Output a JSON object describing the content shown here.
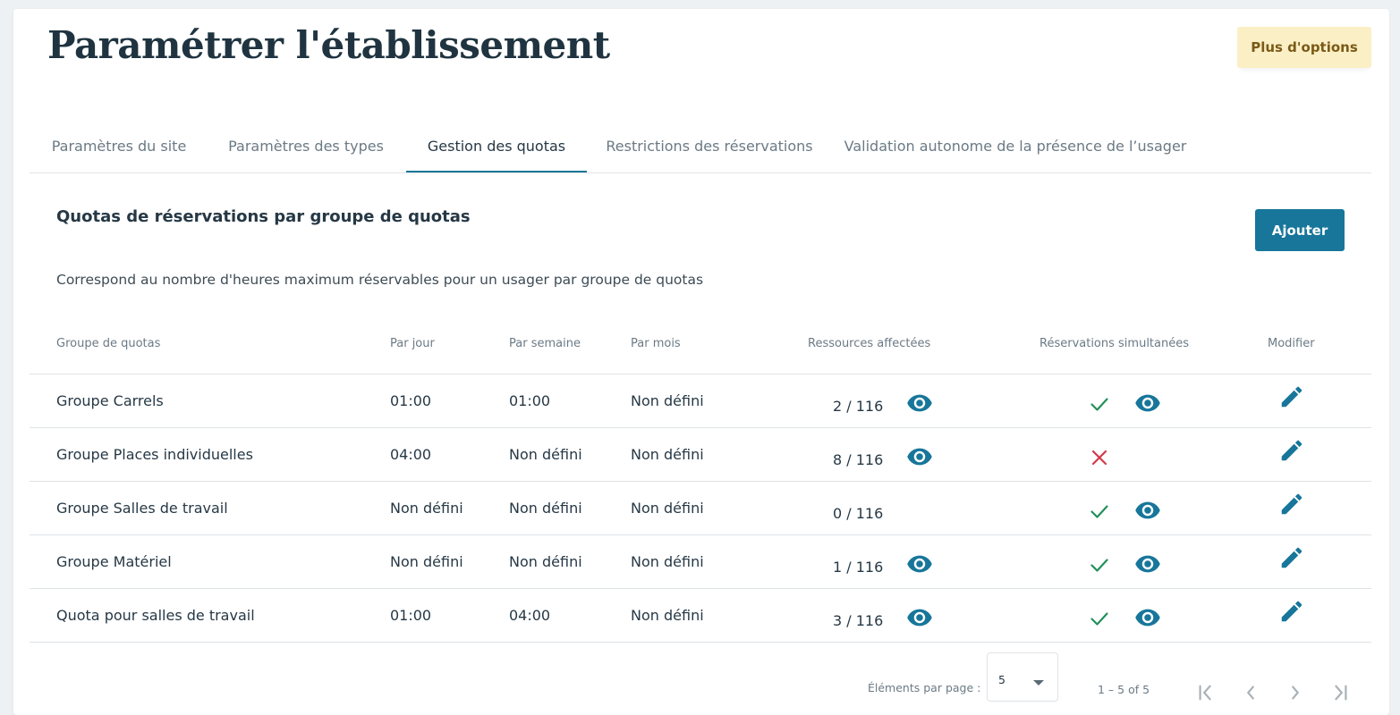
{
  "header": {
    "title": "Paramétrer l'établissement",
    "more_options_label": "Plus d'options"
  },
  "tabs": [
    {
      "label": "Paramètres du site",
      "active": false
    },
    {
      "label": "Paramètres des types",
      "active": false
    },
    {
      "label": "Gestion des quotas",
      "active": true
    },
    {
      "label": "Restrictions des réservations",
      "active": false
    },
    {
      "label": "Validation autonome de la présence de l’usager",
      "active": false
    }
  ],
  "section": {
    "title": "Quotas de réservations par groupe de quotas",
    "add_label": "Ajouter",
    "description": "Correspond au nombre d'heures maximum réservables pour un usager par groupe de quotas"
  },
  "table": {
    "columns": {
      "group": "Groupe de quotas",
      "day": "Par jour",
      "week": "Par semaine",
      "month": "Par mois",
      "resources": "Ressources affectées",
      "simultaneous": "Réservations simultanées",
      "edit": "Modifier"
    },
    "rows": [
      {
        "group": "Groupe Carrels",
        "day": "01:00",
        "week": "01:00",
        "month": "Non défini",
        "resources": "2 / 116",
        "resources_view": true,
        "simultaneous": true,
        "simultaneous_view": true
      },
      {
        "group": "Groupe Places individuelles",
        "day": "04:00",
        "week": "Non défini",
        "month": "Non défini",
        "resources": "8 / 116",
        "resources_view": true,
        "simultaneous": false,
        "simultaneous_view": false
      },
      {
        "group": "Groupe Salles de travail",
        "day": "Non défini",
        "week": "Non défini",
        "month": "Non défini",
        "resources": "0 / 116",
        "resources_view": false,
        "simultaneous": true,
        "simultaneous_view": true
      },
      {
        "group": "Groupe Matériel",
        "day": "Non défini",
        "week": "Non défini",
        "month": "Non défini",
        "resources": "1 / 116",
        "resources_view": true,
        "simultaneous": true,
        "simultaneous_view": true
      },
      {
        "group": "Quota pour salles de travail",
        "day": "01:00",
        "week": "04:00",
        "month": "Non défini",
        "resources": "3 / 116",
        "resources_view": true,
        "simultaneous": true,
        "simultaneous_view": true
      }
    ]
  },
  "paginator": {
    "items_per_page_label": "Éléments par page :",
    "page_size": "5",
    "range_label": "1 – 5 of 5"
  },
  "icons": {
    "eye": "eye-icon",
    "check": "check-icon",
    "cross": "close-icon",
    "edit": "pencil-icon",
    "first": "first-page-icon",
    "prev": "chevron-left-icon",
    "next": "chevron-right-icon",
    "last": "last-page-icon"
  },
  "colors": {
    "primary": "#17769a",
    "check": "#21905a",
    "cross": "#d43a4a",
    "options_bg": "#fbefc6",
    "options_text": "#7a5a17",
    "pager_icon": "#a9b2b8"
  }
}
